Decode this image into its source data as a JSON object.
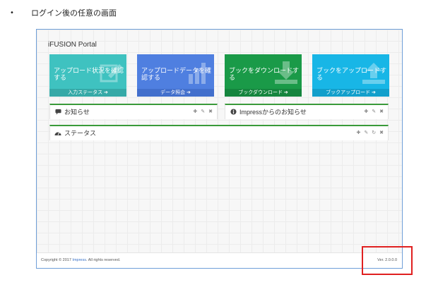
{
  "doc": {
    "bullet": "•",
    "caption": "ログイン後の任意の画面"
  },
  "portal": {
    "title": "iFUSION Portal",
    "tiles": [
      {
        "text": "アップロード状況を確認する",
        "footer": "入力ステータス",
        "color": "#3fc2c0",
        "foot_color": "#35a9a7"
      },
      {
        "text": "アップロードデータを確認する",
        "footer": "データ照会",
        "color": "#4f7fe0",
        "foot_color": "#426fcc"
      },
      {
        "text": "ブックをダウンロードする",
        "footer": "ブックダウンロード",
        "color": "#1a9a48",
        "foot_color": "#15853e"
      },
      {
        "text": "ブックをアップロードする",
        "footer": "ブックアップロード",
        "color": "#18b6e6",
        "foot_color": "#129fcb"
      }
    ],
    "panels": {
      "news": {
        "title": "お知らせ",
        "icon": "comment-icon"
      },
      "impress_news": {
        "title": "Impressからのお知らせ",
        "icon": "info-icon"
      },
      "status": {
        "title": "ステータス",
        "icon": "dashboard-icon"
      }
    },
    "footer": {
      "copyright_prefix": "Copyright © 2017 ",
      "copyright_link": "Impress",
      "copyright_suffix": ". All rights reserved.",
      "version": "Ver. 2.0.0.0"
    }
  }
}
